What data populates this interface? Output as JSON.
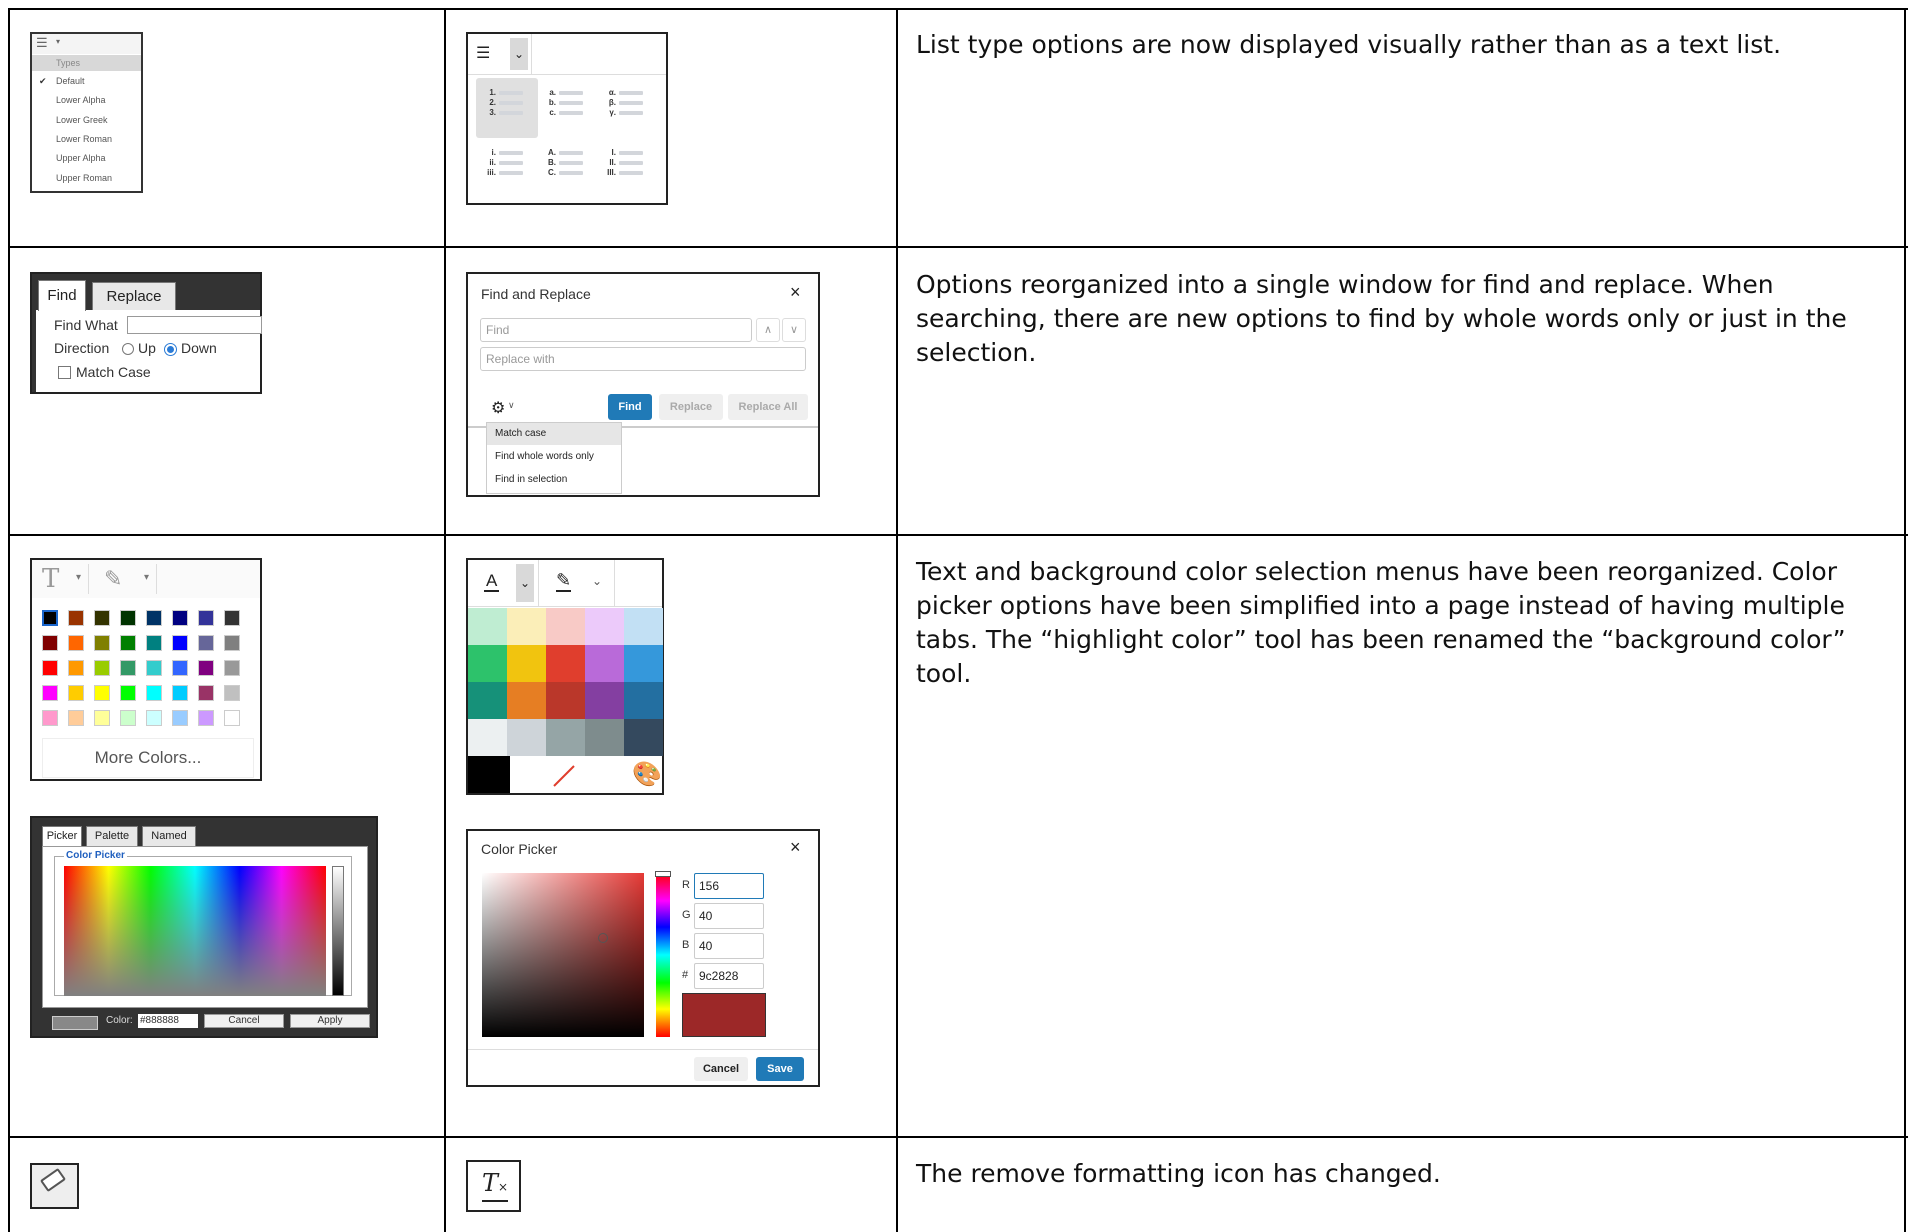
{
  "rows": [
    {
      "description": "List type options are now displayed visually rather than as a text list."
    },
    {
      "description": "Options reorganized into a single window for find and replace. When searching, there are new options to find by whole words only or just in the selection."
    },
    {
      "description": "Text and background color selection menus have been reorganized. Color picker options have been simplified into a page instead of having multiple tabs. The “highlight color” tool has been renamed the “background color” tool."
    },
    {
      "description": "The remove formatting icon has changed."
    }
  ],
  "old_list_menu": {
    "header": "Types",
    "items": [
      "Default",
      "Lower Alpha",
      "Lower Greek",
      "Lower Roman",
      "Upper Alpha",
      "Upper Roman"
    ],
    "checked_item": "Default"
  },
  "new_list_menu": {
    "styles": [
      {
        "name": "decimal",
        "markers": [
          "1.",
          "2.",
          "3."
        ]
      },
      {
        "name": "lower-alpha",
        "markers": [
          "a.",
          "b.",
          "c."
        ]
      },
      {
        "name": "lower-greek",
        "markers": [
          "α.",
          "β.",
          "γ."
        ]
      },
      {
        "name": "lower-roman",
        "markers": [
          "i.",
          "ii.",
          "iii."
        ]
      },
      {
        "name": "upper-alpha",
        "markers": [
          "A.",
          "B.",
          "C."
        ]
      },
      {
        "name": "upper-roman",
        "markers": [
          "I.",
          "II.",
          "III."
        ]
      }
    ]
  },
  "old_find": {
    "tabs": [
      "Find",
      "Replace"
    ],
    "find_what_label": "Find What",
    "direction_label": "Direction",
    "up_label": "Up",
    "down_label": "Down",
    "match_case_label": "Match Case"
  },
  "new_find": {
    "title": "Find and Replace",
    "find_placeholder": "Find",
    "replace_placeholder": "Replace with",
    "find_button": "Find",
    "replace_button": "Replace",
    "replace_all_button": "Replace All",
    "options": [
      "Match case",
      "Find whole words only",
      "Find in selection"
    ]
  },
  "old_color_palette": {
    "more_colors_label": "More Colors...",
    "colors": [
      [
        "#000000",
        "#993300",
        "#333300",
        "#003300",
        "#003366",
        "#000080",
        "#333399",
        "#333333"
      ],
      [
        "#800000",
        "#ff6600",
        "#808000",
        "#008000",
        "#008080",
        "#0000ff",
        "#666699",
        "#808080"
      ],
      [
        "#ff0000",
        "#ff9900",
        "#99cc00",
        "#339966",
        "#33cccc",
        "#3366ff",
        "#800080",
        "#999999"
      ],
      [
        "#ff00ff",
        "#ffcc00",
        "#ffff00",
        "#00ff00",
        "#00ffff",
        "#00ccff",
        "#993366",
        "#c0c0c0"
      ],
      [
        "#ff99cc",
        "#ffcc99",
        "#ffff99",
        "#ccffcc",
        "#ccffff",
        "#99ccff",
        "#cc99ff",
        "#ffffff"
      ]
    ]
  },
  "old_color_picker": {
    "tabs": [
      "Picker",
      "Palette",
      "Named"
    ],
    "group_label": "Color Picker",
    "color_label": "Color:",
    "color_value": "#888888",
    "cancel_label": "Cancel",
    "apply_label": "Apply"
  },
  "new_color_palette": {
    "colors": [
      [
        "#bfedd2",
        "#fbeeb8",
        "#f8cac6",
        "#eccafa",
        "#c2e0f4"
      ],
      [
        "#2dc26b",
        "#f1c40f",
        "#e03e2d",
        "#b96ad9",
        "#3598db"
      ],
      [
        "#169179",
        "#e67e23",
        "#ba372a",
        "#843fa1",
        "#236fa1"
      ],
      [
        "#ecf0f1",
        "#ced4d9",
        "#95a5a6",
        "#7e8c8d",
        "#34495e"
      ]
    ],
    "last_row_black": "#000000"
  },
  "new_color_picker": {
    "title": "Color Picker",
    "r_label": "R",
    "r_value": "156",
    "g_label": "G",
    "g_value": "40",
    "b_label": "B",
    "b_value": "40",
    "hex_label": "#",
    "hex_value": "9c2828",
    "preview_color": "#9c2828",
    "cancel_label": "Cancel",
    "save_label": "Save"
  },
  "accent_color": "#207ab7"
}
